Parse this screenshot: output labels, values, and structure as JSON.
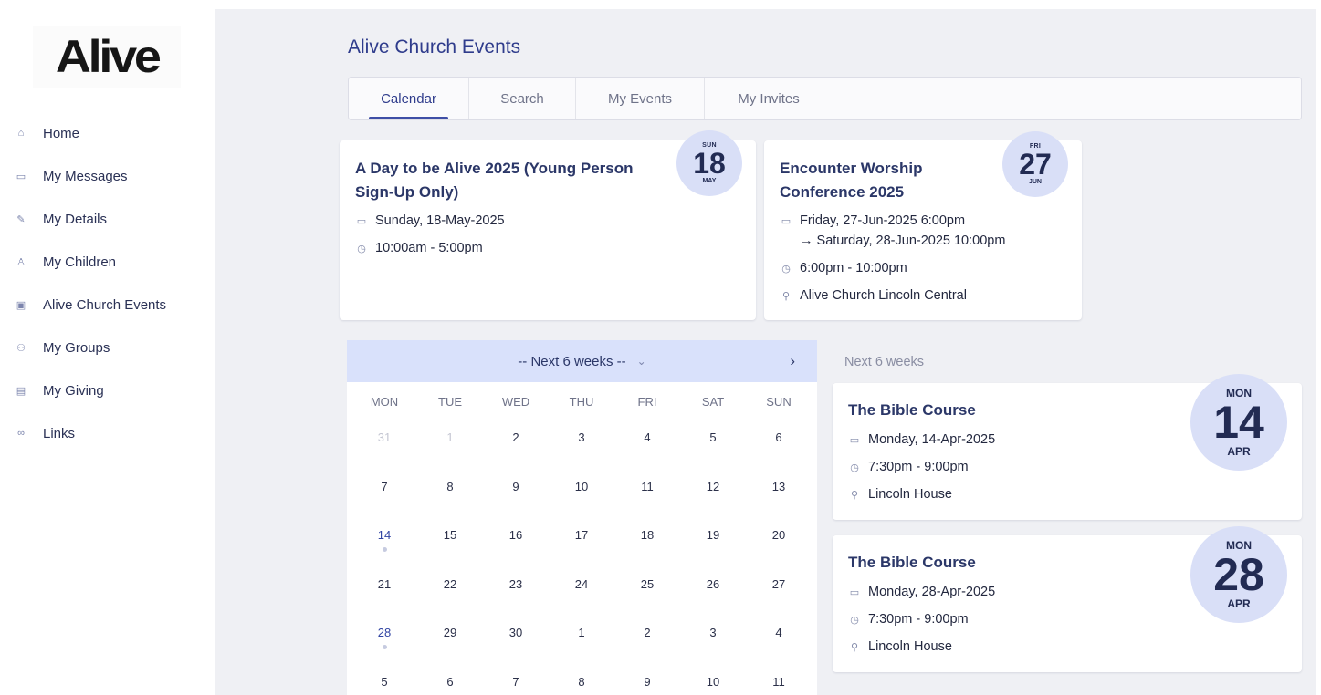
{
  "brand": {
    "logo_text": "Alive"
  },
  "sidebar": {
    "items": [
      {
        "label": "Home",
        "icon": "home-icon",
        "glyph": "⌂"
      },
      {
        "label": "My Messages",
        "icon": "message-icon",
        "glyph": "▭"
      },
      {
        "label": "My Details",
        "icon": "pencil-icon",
        "glyph": "✎"
      },
      {
        "label": "My Children",
        "icon": "shirt-icon",
        "glyph": "♙"
      },
      {
        "label": "Alive Church Events",
        "icon": "calendar-clock-icon",
        "glyph": "▣"
      },
      {
        "label": "My Groups",
        "icon": "group-icon",
        "glyph": "⚇"
      },
      {
        "label": "My Giving",
        "icon": "credit-card-icon",
        "glyph": "▤"
      },
      {
        "label": "Links",
        "icon": "link-icon",
        "glyph": "∞"
      }
    ]
  },
  "page": {
    "title": "Alive Church Events"
  },
  "tabs": [
    {
      "label": "Calendar",
      "active": true
    },
    {
      "label": "Search",
      "active": false
    },
    {
      "label": "My Events",
      "active": false
    },
    {
      "label": "My Invites",
      "active": false
    }
  ],
  "featured": [
    {
      "title_line1": "A Day to be Alive 2025 (Young Person",
      "title_line2": "Sign-Up Only)",
      "date": "Sunday, 18-May-2025",
      "time": "10:00am - 5:00pm",
      "badge": {
        "dow": "SUN",
        "day": "18",
        "month": "MAY"
      }
    },
    {
      "title_line1": "Encounter Worship",
      "title_line2": "Conference 2025",
      "date": "Friday, 27-Jun-2025 6:00pm",
      "date_end": "→ Saturday, 28-Jun-2025 10:00pm",
      "time": "6:00pm - 10:00pm",
      "location": "Alive Church Lincoln Central",
      "badge": {
        "dow": "FRI",
        "day": "27",
        "month": "JUN"
      }
    }
  ],
  "calendar": {
    "range_label": "-- Next 6 weeks --",
    "next_label": "›",
    "chevron": "⌄",
    "weekdays": [
      "MON",
      "TUE",
      "WED",
      "THU",
      "FRI",
      "SAT",
      "SUN"
    ],
    "weeks": [
      [
        "31",
        "1",
        "2",
        "3",
        "4",
        "5",
        "6"
      ],
      [
        "7",
        "8",
        "9",
        "10",
        "11",
        "12",
        "13"
      ],
      [
        "14",
        "15",
        "16",
        "17",
        "18",
        "19",
        "20"
      ],
      [
        "21",
        "22",
        "23",
        "24",
        "25",
        "26",
        "27"
      ],
      [
        "28",
        "29",
        "30",
        "1",
        "2",
        "3",
        "4"
      ],
      [
        "5",
        "6",
        "7",
        "8",
        "9",
        "10",
        "11"
      ]
    ],
    "muted": [
      "0-0",
      "0-1"
    ],
    "event_days": [
      "2-0",
      "4-0"
    ]
  },
  "upcoming": {
    "heading": "Next 6 weeks",
    "events": [
      {
        "title": "The Bible Course",
        "date": "Monday, 14-Apr-2025",
        "time": "7:30pm - 9:00pm",
        "location": "Lincoln House",
        "badge": {
          "dow": "MON",
          "day": "14",
          "month": "APR"
        }
      },
      {
        "title": "The Bible Course",
        "date": "Monday, 28-Apr-2025",
        "time": "7:30pm - 9:00pm",
        "location": "Lincoln House",
        "badge": {
          "dow": "MON",
          "day": "28",
          "month": "APR"
        }
      }
    ]
  },
  "icons": {
    "calendar": "▭",
    "clock": "◷",
    "pin": "⚲"
  },
  "colors": {
    "accent": "#2f3c8c",
    "badge_bg": "#d9dff7",
    "calendar_header_bg": "#d9e1fb",
    "page_bg": "#eff0f4"
  }
}
